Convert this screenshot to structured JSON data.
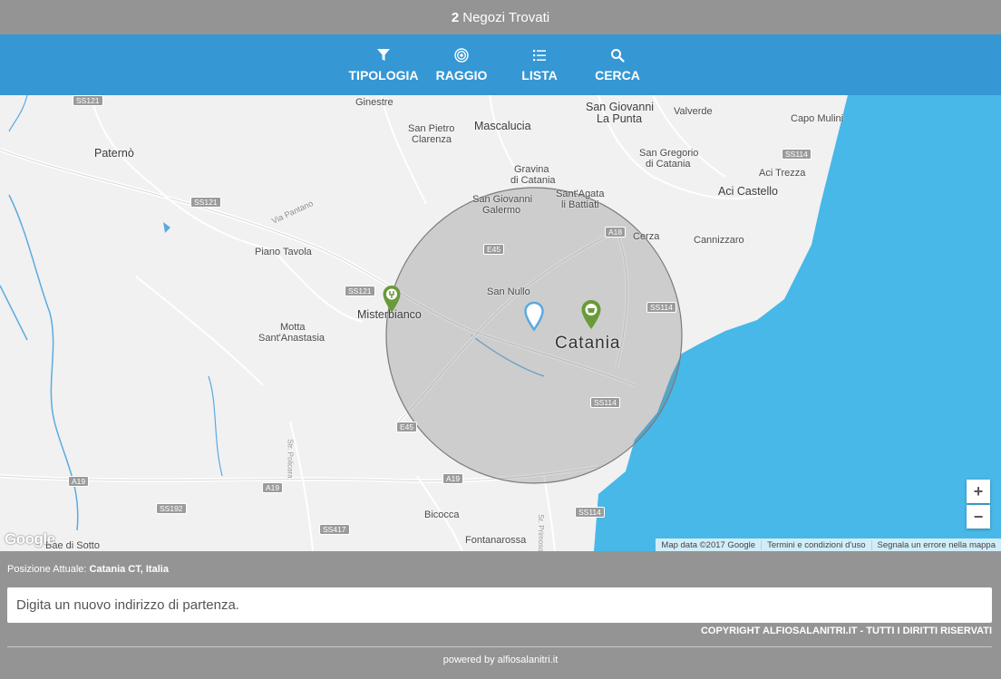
{
  "header": {
    "count": "2",
    "title": "Negozi Trovati"
  },
  "nav": {
    "items": [
      {
        "label": "TIPOLOGIA",
        "icon": "filter-icon"
      },
      {
        "label": "RAGGIO",
        "icon": "radius-icon"
      },
      {
        "label": "LISTA",
        "icon": "list-icon"
      },
      {
        "label": "CERCA",
        "icon": "search-icon"
      }
    ]
  },
  "map": {
    "places": {
      "ginestre": "Ginestre",
      "san_pietro": "San Pietro",
      "clarenza": "Clarenza",
      "mascalucia": "Mascalucia",
      "san_giovanni_punta_1": "San Giovanni",
      "san_giovanni_punta_2": "La Punta",
      "valverde": "Valverde",
      "capo_mulini": "Capo Mulini",
      "paterno": "Paternò",
      "san_gregorio_1": "San Gregorio",
      "san_gregorio_2": "di Catania",
      "aci_trezza": "Aci Trezza",
      "gravina_1": "Gravina",
      "gravina_2": "di Catania",
      "aci_castello": "Aci Castello",
      "sg_galermo_1": "San Giovanni",
      "sg_galermo_2": "Galermo",
      "santagata_1": "Sant'Agata",
      "santagata_2": "li Battiati",
      "cerza": "Cerza",
      "cannizzaro": "Cannizzaro",
      "piano_tavola": "Piano Tavola",
      "via_pantano": "Via Pantano",
      "san_nullo": "San Nullo",
      "misterbianco": "Misterbianco",
      "motta_1": "Motta",
      "motta_2": "Sant'Anastasia",
      "catania": "Catania",
      "bicocca": "Bicocca",
      "fontanarossa": "Fontanarossa",
      "bae_di_sotto": "Bae di Sotto",
      "sr_primosole": "Sr. Primosole",
      "str_policara": "Str. Policara"
    },
    "shields": {
      "ss121_a": "SS121",
      "ss121_b": "SS121",
      "ss121_c": "SS121",
      "e45_a": "E45",
      "e45_b": "E45",
      "a18": "A18",
      "ss114_a": "SS114",
      "ss114_b": "SS114",
      "ss114_c": "SS114",
      "ss114_d": "SS114",
      "a19_a": "A19",
      "a19_b": "A19",
      "a19_c": "A19",
      "ss192": "SS192",
      "ss417": "SS417"
    },
    "zoom_in": "+",
    "zoom_out": "−",
    "google": "Google",
    "attribution": [
      "Map data ©2017 Google",
      "Termini e condizioni d'uso",
      "Segnala un errore nella mappa"
    ],
    "colors": {
      "sea": "#47b8e8",
      "land": "#f1f1f1",
      "radius": "#7a7a7a",
      "store_marker": "#6a9a3a",
      "user_marker": "#5aaae0"
    }
  },
  "footer": {
    "position_label": "Posizione Attuale:",
    "position_value": "Catania CT, Italia",
    "address_placeholder": "Digita un nuovo indirizzo di partenza.",
    "copyright": "COPYRIGHT ALFIOSALANITRI.IT - TUTTI I DIRITTI RISERVATI",
    "powered": "powered by alfiosalanitri.it"
  }
}
